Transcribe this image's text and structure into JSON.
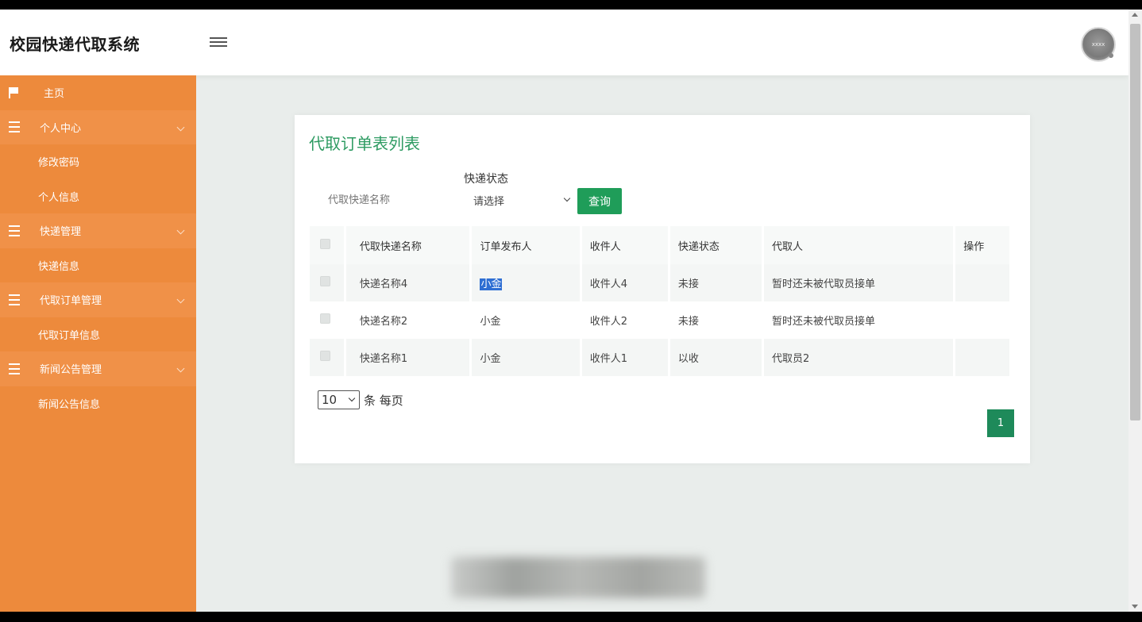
{
  "app": {
    "title": "校园快递代取系统"
  },
  "avatar": {
    "text": "xxxx"
  },
  "sidebar": {
    "items": [
      {
        "label": "主页",
        "type": "home",
        "icon": "flag-icon"
      },
      {
        "label": "个人中心",
        "type": "parent",
        "icon": "list-icon"
      },
      {
        "label": "修改密码",
        "type": "child"
      },
      {
        "label": "个人信息",
        "type": "child"
      },
      {
        "label": "快递管理",
        "type": "parent",
        "icon": "list-icon"
      },
      {
        "label": "快递信息",
        "type": "child"
      },
      {
        "label": "代取订单管理",
        "type": "parent",
        "icon": "list-icon"
      },
      {
        "label": "代取订单信息",
        "type": "child"
      },
      {
        "label": "新闻公告管理",
        "type": "parent",
        "icon": "list-icon"
      },
      {
        "label": "新闻公告信息",
        "type": "child"
      }
    ]
  },
  "main": {
    "title": "代取订单表列表",
    "search": {
      "placeholder": "代取快递名称",
      "value": ""
    },
    "status_filter": {
      "label": "快递状态",
      "selected": "请选择"
    },
    "query_button": "查询",
    "table": {
      "columns": [
        "代取快递名称",
        "订单发布人",
        "收件人",
        "快递状态",
        "代取人",
        "操作"
      ],
      "rows": [
        [
          "快递名称4",
          "小金",
          "收件人4",
          "未接",
          "暂时还未被代取员接单",
          ""
        ],
        [
          "快递名称2",
          "小金",
          "收件人2",
          "未接",
          "暂时还未被代取员接单",
          ""
        ],
        [
          "快递名称1",
          "小金",
          "收件人1",
          "以收",
          "代取员2",
          ""
        ]
      ]
    },
    "pagination": {
      "page_size": "10",
      "per_page_label": "条 每页",
      "current_page": "1"
    }
  },
  "colors": {
    "sidebar": "#ed8a3c",
    "accent": "#1f9d59",
    "title": "#2e9b62"
  }
}
